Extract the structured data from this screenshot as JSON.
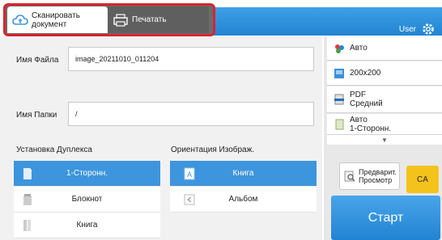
{
  "tabs": [
    {
      "label": "Сканировать документ",
      "line1": "Сканировать",
      "line2": "документ",
      "icon": "cloud-scan-icon",
      "active": true
    },
    {
      "label": "Печатать",
      "icon": "printer-icon",
      "active": false
    }
  ],
  "header": {
    "user_label": "User",
    "settings_icon": "gear-icon"
  },
  "form": {
    "file_name_label": "Имя Файла",
    "file_name_value": "image_20211010_011204",
    "folder_name_label": "Имя Папки",
    "folder_name_value": "/"
  },
  "duplex": {
    "title": "Установка Дуплекса",
    "options": [
      {
        "label": "1-Сторонн.",
        "selected": true,
        "icon": "single-side-icon"
      },
      {
        "label": "Блокнот",
        "selected": false,
        "icon": "tablet-icon"
      },
      {
        "label": "Книга",
        "selected": false,
        "icon": "book-icon"
      }
    ]
  },
  "orientation": {
    "title": "Ориентация Изображ.",
    "options": [
      {
        "label": "Книга",
        "selected": true,
        "icon": "portrait-a-icon"
      },
      {
        "label": "Альбом",
        "selected": false,
        "icon": "landscape-a-icon"
      }
    ]
  },
  "right_panel": {
    "items": [
      {
        "line1": "Авто",
        "line2": "",
        "icon": "color-mode-icon"
      },
      {
        "line1": "200x200",
        "line2": "",
        "icon": "resolution-icon"
      },
      {
        "line1": "PDF",
        "line2": "Средний",
        "icon": "file-format-icon"
      },
      {
        "line1": "Авто",
        "line2": "1-Сторонн.",
        "icon": "original-size-icon"
      }
    ],
    "more_icon": "chevron-down-icon"
  },
  "actions": {
    "preview_line1": "Предварит.",
    "preview_line2": "Просмотр",
    "ca_label": "CA",
    "start_label": "Старт"
  },
  "colors": {
    "accent_blue": "#3d95dd",
    "highlight_red": "#d8242f",
    "ca_yellow": "#f3c31c"
  }
}
